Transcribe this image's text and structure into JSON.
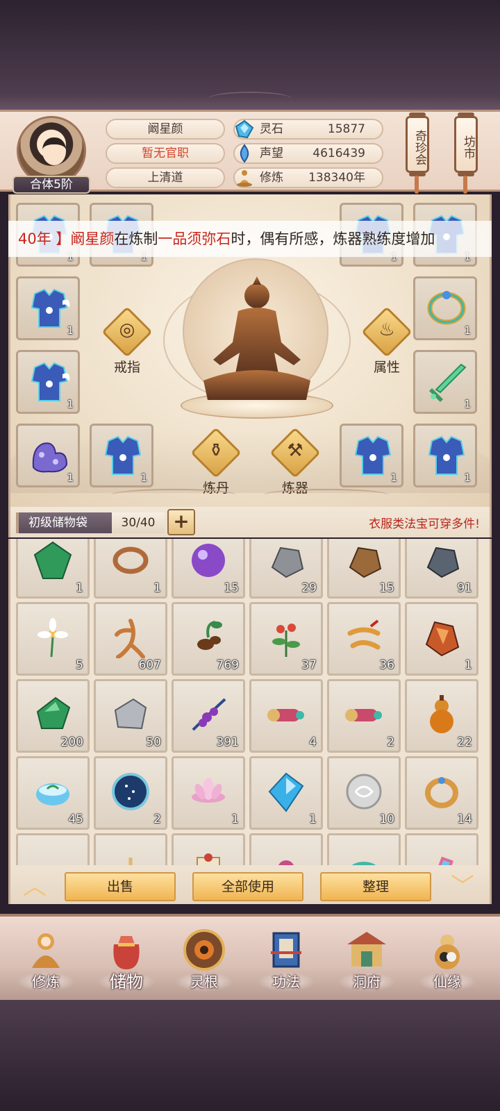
{
  "player": {
    "name": "阚星颜",
    "official_rank": "暂无官职",
    "sect": "上清道",
    "realm": "合体5阶"
  },
  "resources": [
    {
      "icon": "spirit-stone-icon",
      "label": "灵石",
      "value": "15877"
    },
    {
      "icon": "prestige-icon",
      "label": "声望",
      "value": "4616439"
    },
    {
      "icon": "cultivation-icon",
      "label": "修炼",
      "value": "138340年"
    }
  ],
  "side_buttons": {
    "treasure_hall": "奇珍会",
    "market": "坊市"
  },
  "equipment": {
    "marquee_prefix": "40年 】",
    "marquee_name": "阚星颜",
    "marquee_mid1": "在炼制",
    "marquee_item": "一品须弥石",
    "marquee_mid2": "时，偶有所感，炼器熟练度增加",
    "ring_label": "戒指",
    "attribute_label": "属性",
    "alchemy_label": "炼丹",
    "forge_label": "炼器",
    "slot_counts": {
      "l1": "1",
      "l2": "1",
      "r1": "1",
      "r2": "1",
      "l3": "1",
      "r3": "1",
      "l4": "1",
      "r4": "1",
      "l5": "1",
      "l6": "1",
      "r5": "1",
      "r6": "1"
    }
  },
  "bag": {
    "name": "初级储物袋",
    "capacity": "30/40",
    "add_label": "+",
    "tip": "衣服类法宝可穿多件!"
  },
  "inventory": [
    {
      "icon": "jade-icon",
      "count": "1"
    },
    {
      "icon": "bracelet-icon",
      "count": "1"
    },
    {
      "icon": "purple-orb-icon",
      "count": "15"
    },
    {
      "icon": "ore-icon",
      "count": "29"
    },
    {
      "icon": "brown-ore-icon",
      "count": "15"
    },
    {
      "icon": "dark-stone-icon",
      "count": "91"
    },
    {
      "icon": "white-flower-icon",
      "count": "5"
    },
    {
      "icon": "ginseng-icon",
      "count": "607"
    },
    {
      "icon": "root-herb-icon",
      "count": "769"
    },
    {
      "icon": "red-herb-icon",
      "count": "37"
    },
    {
      "icon": "cordyceps-icon",
      "count": "36"
    },
    {
      "icon": "fire-crystal-icon",
      "count": "1"
    },
    {
      "icon": "green-jade-icon",
      "count": "200"
    },
    {
      "icon": "silver-ore-icon",
      "count": "50"
    },
    {
      "icon": "purple-berry-icon",
      "count": "391"
    },
    {
      "icon": "scroll-case-icon",
      "count": "4"
    },
    {
      "icon": "scroll-case-icon",
      "count": "2"
    },
    {
      "icon": "gourd-icon",
      "count": "22"
    },
    {
      "icon": "spirit-tea-icon",
      "count": "45"
    },
    {
      "icon": "star-disc-icon",
      "count": "2"
    },
    {
      "icon": "lotus-icon",
      "count": "1"
    },
    {
      "icon": "blue-crystal-icon",
      "count": "1"
    },
    {
      "icon": "silver-orb-icon",
      "count": "10"
    },
    {
      "icon": "gold-ring-icon",
      "count": "14"
    },
    {
      "icon": "cloud-token-icon",
      "count": ""
    },
    {
      "icon": "teapot-icon",
      "count": ""
    },
    {
      "icon": "paper-scroll-icon",
      "count": ""
    },
    {
      "icon": "jewel-box-icon",
      "count": ""
    },
    {
      "icon": "jade-ring-icon",
      "count": ""
    },
    {
      "icon": "talisman-icon",
      "count": ""
    }
  ],
  "actions": {
    "sell": "出售",
    "use_all": "全部使用",
    "sort": "整理"
  },
  "nav": [
    {
      "icon": "cultivate-icon",
      "label": "修炼"
    },
    {
      "icon": "storage-bag-icon",
      "label": "储物"
    },
    {
      "icon": "spirit-root-icon",
      "label": "灵根"
    },
    {
      "icon": "technique-book-icon",
      "label": "功法"
    },
    {
      "icon": "cave-mansion-icon",
      "label": "洞府"
    },
    {
      "icon": "fate-gourd-icon",
      "label": "仙缘"
    }
  ],
  "colors": {
    "accent_red": "#c7261c",
    "gold_button": "#f0b552",
    "panel_bg": "#efe3d3"
  }
}
